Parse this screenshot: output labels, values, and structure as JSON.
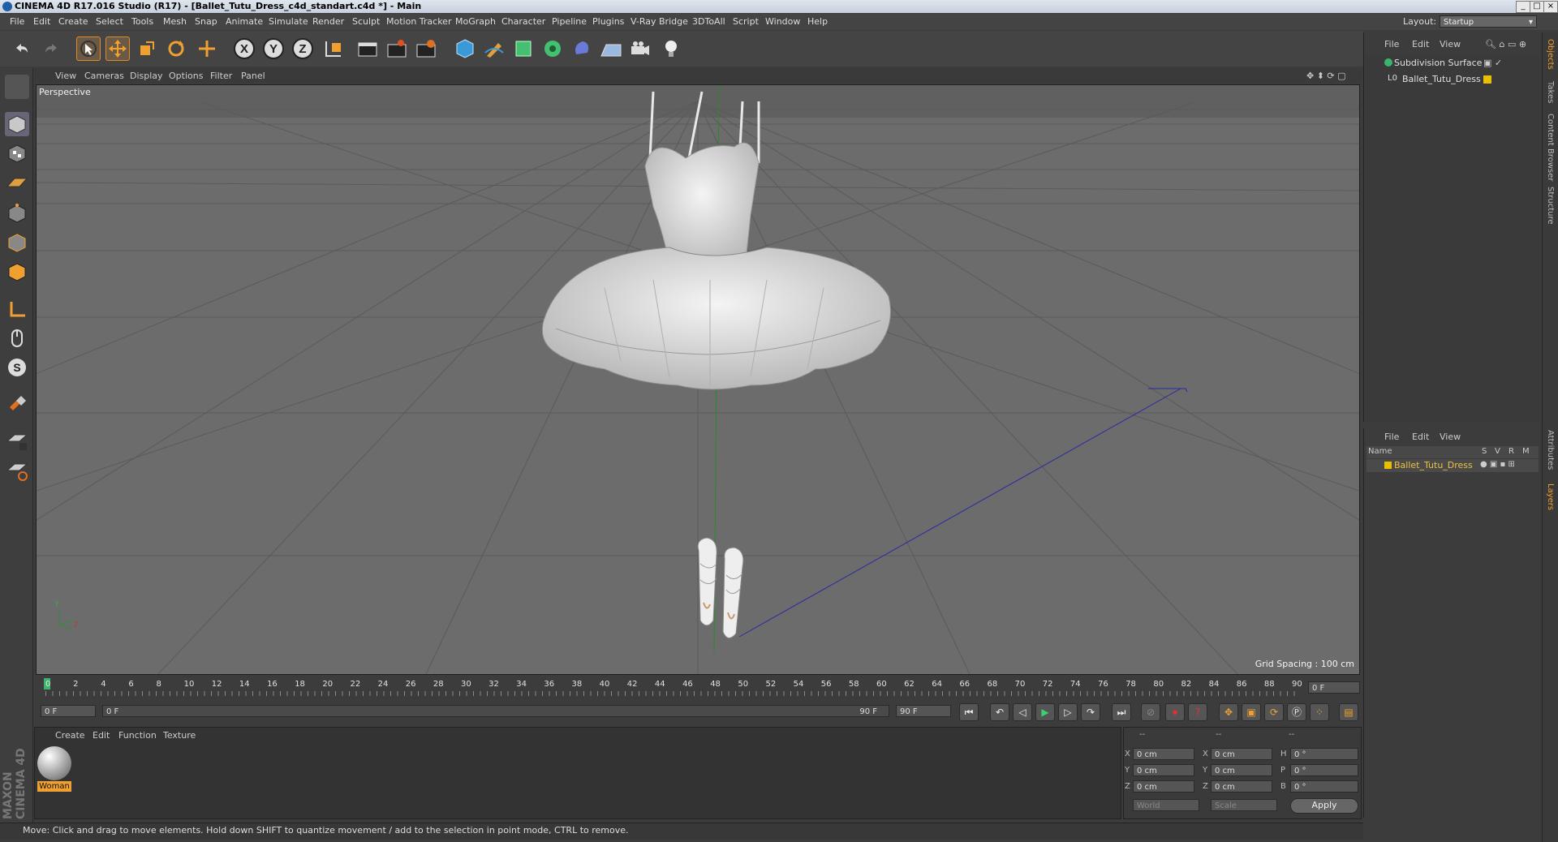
{
  "window": {
    "title": "CINEMA 4D R17.016 Studio (R17) - [Ballet_Tutu_Dress_c4d_standart.c4d *] - Main",
    "controls": [
      "_",
      "□",
      "×"
    ]
  },
  "menubar": {
    "items": [
      "File",
      "Edit",
      "Create",
      "Select",
      "Tools",
      "Mesh",
      "Snap",
      "Animate",
      "Simulate",
      "Render",
      "Sculpt",
      "Motion Tracker",
      "MoGraph",
      "Character",
      "Pipeline",
      "Plugins",
      "V-Ray Bridge",
      "3DToAll",
      "Script",
      "Window",
      "Help"
    ],
    "layout_label": "Layout:",
    "layout_value": "Startup"
  },
  "toolbar": {
    "icons": [
      "undo-icon",
      "redo-icon",
      "live-selection-icon",
      "move-icon",
      "scale-icon",
      "rotate-icon",
      "recent-tool-icon",
      "x-axis-icon",
      "y-axis-icon",
      "z-axis-icon",
      "coordinate-system-icon",
      "render-view-icon",
      "render-to-picture-viewer-icon",
      "edit-render-settings-icon",
      "cube-icon",
      "pen-icon",
      "subdivision-icon",
      "cloner-icon",
      "deformer-icon",
      "floor-icon",
      "camera-icon",
      "light-icon"
    ],
    "axis_x": "X",
    "axis_y": "Y",
    "axis_z": "Z"
  },
  "viewport": {
    "menu": [
      "View",
      "Cameras",
      "Display",
      "Options",
      "Filter",
      "Panel"
    ],
    "label": "Perspective",
    "grid_spacing": "Grid Spacing : 100 cm",
    "background": "#6e6e6e"
  },
  "object_manager": {
    "menu": [
      "File",
      "Edit",
      "View"
    ],
    "objects": [
      {
        "name": "Subdivision Surface",
        "icon": "subdivision-icon"
      },
      {
        "name": "Ballet_Tutu_Dress",
        "icon": "polygon-object-icon"
      }
    ]
  },
  "layer_manager": {
    "menu": [
      "File",
      "Edit",
      "View"
    ],
    "columns": [
      "Name",
      "S",
      "V",
      "R",
      "M"
    ],
    "layers": [
      {
        "name": "Ballet_Tutu_Dress",
        "color": "#e8c000"
      }
    ]
  },
  "side_tabs": [
    "Objects",
    "Takes",
    "Content Browser",
    "Structure",
    "Attributes",
    "Layers"
  ],
  "timeline": {
    "ticks": [
      "0",
      "2",
      "4",
      "6",
      "8",
      "10",
      "12",
      "14",
      "16",
      "18",
      "20",
      "22",
      "24",
      "26",
      "28",
      "30",
      "32",
      "34",
      "36",
      "38",
      "40",
      "42",
      "44",
      "46",
      "48",
      "50",
      "52",
      "54",
      "56",
      "58",
      "60",
      "62",
      "64",
      "66",
      "68",
      "70",
      "72",
      "74",
      "76",
      "78",
      "80",
      "82",
      "84",
      "86",
      "88",
      "90"
    ],
    "current_frame": "0 F",
    "start": "0 F",
    "slider_start": "0 F",
    "slider_end": "90 F",
    "end": "90 F"
  },
  "material_manager": {
    "menu": [
      "Create",
      "Edit",
      "Function",
      "Texture"
    ],
    "materials": [
      {
        "name": "Woman"
      }
    ]
  },
  "coordinates": {
    "header": [
      "--",
      "--",
      "--"
    ],
    "rows": [
      {
        "a": "X",
        "av": "0 cm",
        "b": "X",
        "bv": "0 cm",
        "c": "H",
        "cv": "0 °"
      },
      {
        "a": "Y",
        "av": "0 cm",
        "b": "Y",
        "bv": "0 cm",
        "c": "P",
        "cv": "0 °"
      },
      {
        "a": "Z",
        "av": "0 cm",
        "b": "Z",
        "bv": "0 cm",
        "c": "B",
        "cv": "0 °"
      }
    ],
    "world": "World",
    "scale": "Scale",
    "apply": "Apply"
  },
  "status": "Move: Click and drag to move elements. Hold down SHIFT to quantize movement / add to the selection in point mode, CTRL to remove.",
  "logo": "MAXON CINEMA 4D",
  "colors": {
    "accent": "#e08a2a",
    "selection": "#f0c040"
  }
}
